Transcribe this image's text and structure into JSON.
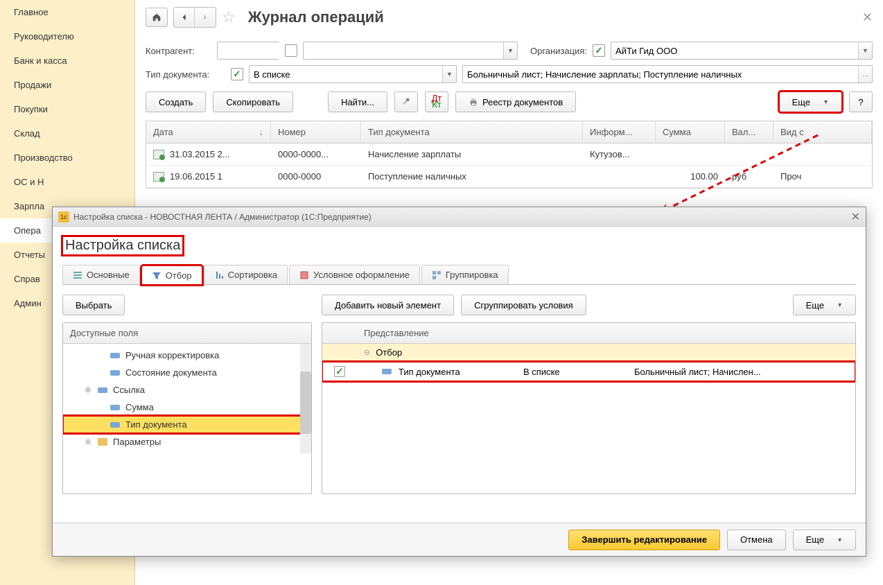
{
  "sidebar": {
    "items": [
      {
        "label": "Главное"
      },
      {
        "label": "Руководителю"
      },
      {
        "label": "Банк и касса"
      },
      {
        "label": "Продажи"
      },
      {
        "label": "Покупки"
      },
      {
        "label": "Склад"
      },
      {
        "label": "Производство"
      },
      {
        "label": "ОС и Н"
      },
      {
        "label": "Зарпла"
      },
      {
        "label": "Опера"
      },
      {
        "label": "Отчеты"
      },
      {
        "label": "Справ"
      },
      {
        "label": "Админ"
      }
    ],
    "active_index": 9
  },
  "header": {
    "title": "Журнал операций"
  },
  "filters": {
    "counterparty_label": "Контрагент:",
    "org_label": "Организация:",
    "org_value": "АйТи Гид ООО",
    "doctype_label": "Тип документа:",
    "doctype_condition": "В списке",
    "doctype_value": "Больничный лист; Начисление зарплаты; Поступление наличных"
  },
  "toolbar": {
    "create": "Создать",
    "copy": "Скопировать",
    "find": "Найти...",
    "registry": "Реестр документов",
    "more": "Еще",
    "help": "?"
  },
  "grid": {
    "columns": [
      "Дата",
      "Номер",
      "Тип документа",
      "Информ...",
      "Сумма",
      "Вал...",
      "Вид с"
    ],
    "rows": [
      {
        "date": "31.03.2015 2...",
        "num": "0000-0000...",
        "type": "Начисление зарплаты",
        "info": "Кутузов...",
        "sum": "",
        "cur": "",
        "kind": ""
      },
      {
        "date": "19.06.2015 1",
        "num": "0000-0000",
        "type": "Поступление наличных",
        "info": "",
        "sum": "100.00",
        "cur": "руб",
        "kind": "Проч"
      }
    ]
  },
  "dialog": {
    "titlebar": "Настройка списка - НОВОСТНАЯ ЛЕНТА / Администратор  (1С:Предприятие)",
    "heading": "Настройка списка",
    "tabs": [
      {
        "label": "Основные"
      },
      {
        "label": "Отбор"
      },
      {
        "label": "Сортировка"
      },
      {
        "label": "Условное оформление"
      },
      {
        "label": "Группировка"
      }
    ],
    "active_tab": 1,
    "left": {
      "choose": "Выбрать",
      "header": "Доступные поля",
      "items": [
        {
          "label": "Ручная корректировка",
          "leaf": true
        },
        {
          "label": "Состояние документа",
          "leaf": true
        },
        {
          "label": "Ссылка",
          "leaf": false
        },
        {
          "label": "Сумма",
          "leaf": true
        },
        {
          "label": "Тип документа",
          "leaf": true,
          "selected": true
        },
        {
          "label": "Параметры",
          "leaf": false,
          "folder": true
        }
      ]
    },
    "right": {
      "add": "Добавить новый элемент",
      "group": "Сгруппировать условия",
      "more": "Еще",
      "header": "Представление",
      "root": "Отбор",
      "row": {
        "field": "Тип документа",
        "cond": "В списке",
        "value": "Больничный лист; Начислен..."
      }
    },
    "footer": {
      "finish": "Завершить редактирование",
      "cancel": "Отмена",
      "more": "Еще"
    }
  }
}
